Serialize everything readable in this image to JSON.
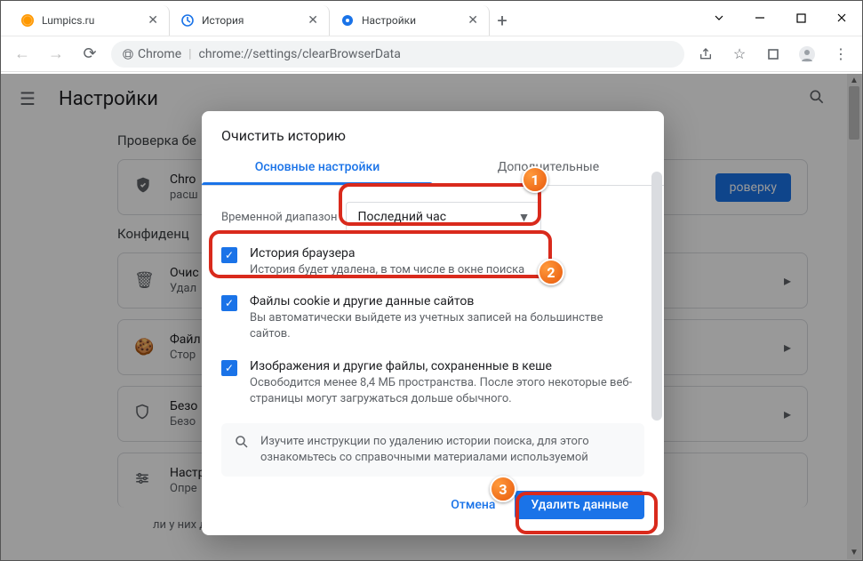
{
  "browser": {
    "tabs": [
      {
        "title": "Lumpics.ru",
        "icon": "orange"
      },
      {
        "title": "История",
        "icon": "history"
      },
      {
        "title": "Настройки",
        "icon": "settings"
      }
    ],
    "url_chip": "Chrome",
    "url_path": "chrome://settings/clearBrowserData"
  },
  "settings": {
    "title": "Настройки",
    "section1": "Проверка бе",
    "card1_t1": "Chro",
    "card1_t2": "расш",
    "card1_btn": "роверку",
    "section2": "Конфиденц",
    "rows": [
      {
        "t1": "Очис",
        "t2": "Удал"
      },
      {
        "t1": "Файл",
        "t2": "Стор"
      },
      {
        "t1": "Безо",
        "t2": "Безо"
      },
      {
        "t1": "Настр",
        "t2": "Опре"
      }
    ],
    "bottom_text": "ли у них доступ к местоположению и камере, а также разрешение на показ всплывающих"
  },
  "dialog": {
    "title": "Очистить историю",
    "tab1": "Основные настройки",
    "tab2": "Дополнительные",
    "range_label": "Временной диапазон",
    "range_value": "Последний час",
    "opt1_t1": "История браузера",
    "opt1_t2": "История будет удалена, в том числе в окне поиска",
    "opt2_t1": "Файлы cookie и другие данные сайтов",
    "opt2_t2": "Вы автоматически выйдете из учетных записей на большинстве сайтов.",
    "opt3_t1": "Изображения и другие файлы, сохраненные в кеше",
    "opt3_t2": "Освободится менее 8,4 МБ пространства. После этого некоторые веб-страницы могут загружаться дольше обычного.",
    "info": "Изучите инструкции по удалению истории поиска, для этого ознакомьтесь со справочными материалами используемой",
    "cancel": "Отмена",
    "confirm": "Удалить данные"
  },
  "badges": {
    "b1": "1",
    "b2": "2",
    "b3": "3"
  }
}
